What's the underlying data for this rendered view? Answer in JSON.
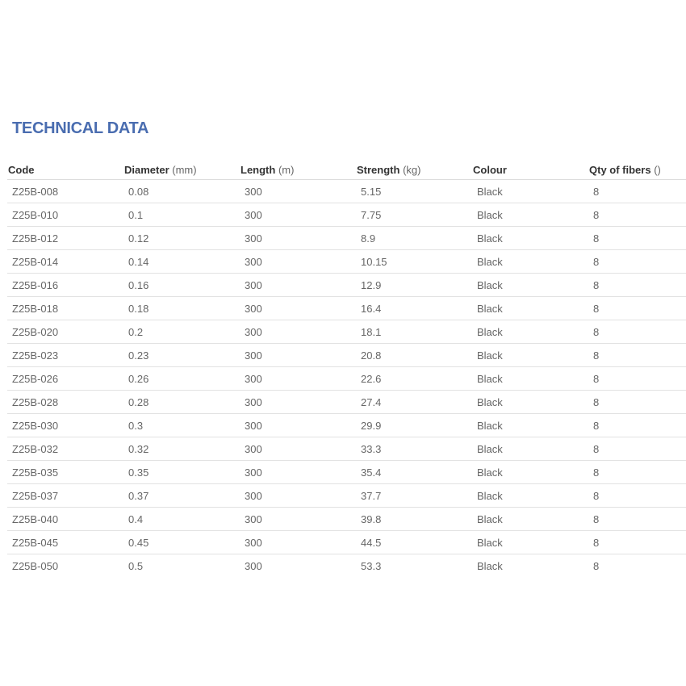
{
  "title": "TECHNICAL DATA",
  "columns": [
    {
      "label": "Code",
      "unit": ""
    },
    {
      "label": "Diameter",
      "unit": "(mm)"
    },
    {
      "label": "Length",
      "unit": "(m)"
    },
    {
      "label": "Strength",
      "unit": "(kg)"
    },
    {
      "label": "Colour",
      "unit": ""
    },
    {
      "label": "Qty of fibers",
      "unit": "()"
    }
  ],
  "rows": [
    [
      "Z25B-008",
      "0.08",
      "300",
      "5.15",
      "Black",
      "8"
    ],
    [
      "Z25B-010",
      "0.1",
      "300",
      "7.75",
      "Black",
      "8"
    ],
    [
      "Z25B-012",
      "0.12",
      "300",
      "8.9",
      "Black",
      "8"
    ],
    [
      "Z25B-014",
      "0.14",
      "300",
      "10.15",
      "Black",
      "8"
    ],
    [
      "Z25B-016",
      "0.16",
      "300",
      "12.9",
      "Black",
      "8"
    ],
    [
      "Z25B-018",
      "0.18",
      "300",
      "16.4",
      "Black",
      "8"
    ],
    [
      "Z25B-020",
      "0.2",
      "300",
      "18.1",
      "Black",
      "8"
    ],
    [
      "Z25B-023",
      "0.23",
      "300",
      "20.8",
      "Black",
      "8"
    ],
    [
      "Z25B-026",
      "0.26",
      "300",
      "22.6",
      "Black",
      "8"
    ],
    [
      "Z25B-028",
      "0.28",
      "300",
      "27.4",
      "Black",
      "8"
    ],
    [
      "Z25B-030",
      "0.3",
      "300",
      "29.9",
      "Black",
      "8"
    ],
    [
      "Z25B-032",
      "0.32",
      "300",
      "33.3",
      "Black",
      "8"
    ],
    [
      "Z25B-035",
      "0.35",
      "300",
      "35.4",
      "Black",
      "8"
    ],
    [
      "Z25B-037",
      "0.37",
      "300",
      "37.7",
      "Black",
      "8"
    ],
    [
      "Z25B-040",
      "0.4",
      "300",
      "39.8",
      "Black",
      "8"
    ],
    [
      "Z25B-045",
      "0.45",
      "300",
      "44.5",
      "Black",
      "8"
    ],
    [
      "Z25B-050",
      "0.5",
      "300",
      "53.3",
      "Black",
      "8"
    ]
  ],
  "colors": {
    "title": "#4a6db0",
    "header_text": "#333333",
    "cell_text": "#666666",
    "row_divider": "#e2e2e2"
  }
}
